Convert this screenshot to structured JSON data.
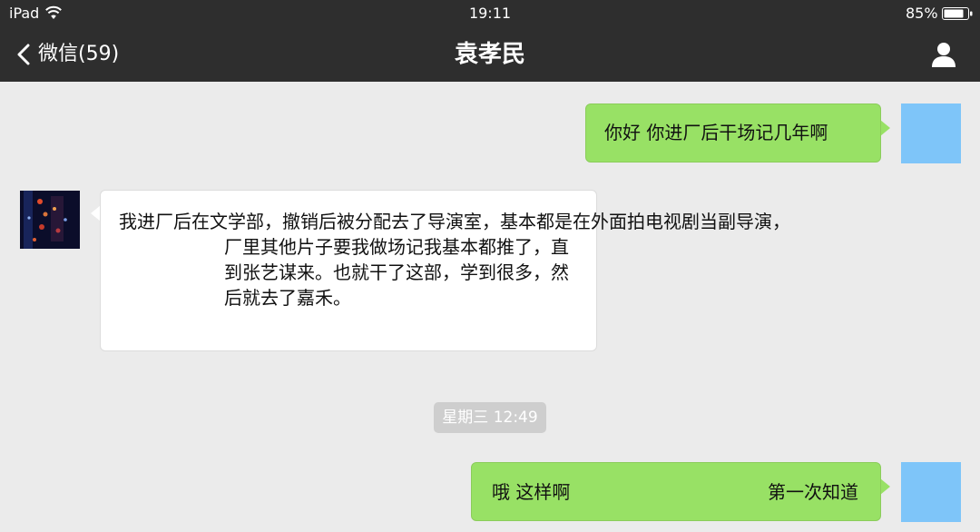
{
  "status_bar": {
    "device": "iPad",
    "time": "19:11",
    "battery": "85%"
  },
  "nav": {
    "back_label": "微信(59)",
    "title": "袁孝民",
    "icons": {
      "back": "chevron-left-icon",
      "profile": "person-icon"
    }
  },
  "messages": [
    {
      "sender": "me",
      "text": "你好 你进厂后干场记几年啊"
    },
    {
      "sender": "other",
      "line1": "我进厂后在文学部，撤销后被分配去了导演室，基本都是在外面拍电视剧当副导演，",
      "line2": "厂里其他片子要我做场记我基本都推了，直到张艺谋来。也就干了这部，学到很多，然后就去了嘉禾。"
    },
    {
      "sender": "me",
      "left": "哦 这样啊",
      "right": "第一次知道"
    }
  ],
  "timestamp": "星期三 12:49",
  "colors": {
    "nav_bg": "#2e2e2e",
    "chat_bg": "#ebebeb",
    "outgoing_bubble": "#98e165",
    "incoming_bubble": "#ffffff",
    "my_avatar": "#7ec5f9",
    "timestamp_bg": "#cecece"
  }
}
